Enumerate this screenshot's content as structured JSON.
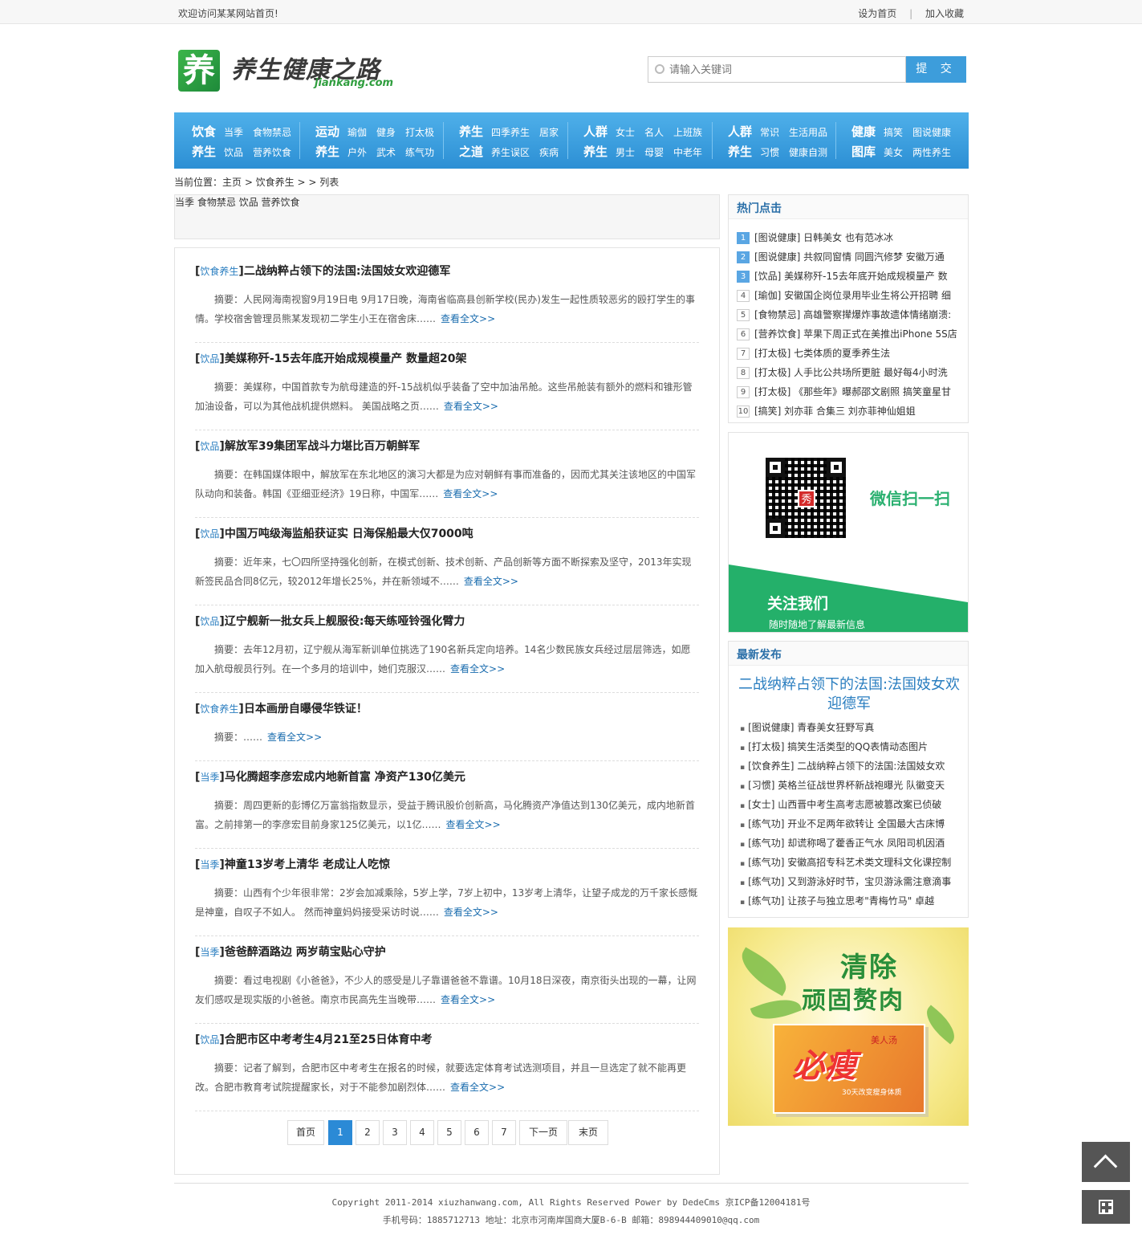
{
  "topbar": {
    "welcome": "欢迎访问某某网站首页!",
    "set_home": "设为首页",
    "separator": "|",
    "bookmark": "加入收藏"
  },
  "logo": {
    "mark": "养",
    "name": "养生健康之路",
    "domain": "jiankang.com"
  },
  "search": {
    "placeholder": "请输入关键词",
    "button": "提 交"
  },
  "nav": [
    {
      "head1": "饮食",
      "subs1": [
        "当季",
        "食物禁忌"
      ],
      "head2": "养生",
      "subs2": [
        "饮品",
        "营养饮食"
      ]
    },
    {
      "head1": "运动",
      "subs1": [
        "瑜伽",
        "健身",
        "打太极"
      ],
      "head2": "养生",
      "subs2": [
        "户外",
        "武术",
        "练气功"
      ]
    },
    {
      "head1": "养生",
      "subs1": [
        "四季养生",
        "居家"
      ],
      "head2": "之道",
      "subs2": [
        "养生误区",
        "疾病"
      ]
    },
    {
      "head1": "人群",
      "subs1": [
        "女士",
        "名人",
        "上班族"
      ],
      "head2": "养生",
      "subs2": [
        "男士",
        "母婴",
        "中老年"
      ]
    },
    {
      "head1": "人群",
      "subs1": [
        "常识",
        "生活用品"
      ],
      "head2": "养生",
      "subs2": [
        "习惯",
        "健康自测"
      ]
    },
    {
      "head1": "健康",
      "subs1": [
        "搞笑",
        "图说健康"
      ],
      "head2": "图库",
      "subs2": [
        "美女",
        "两性养生"
      ]
    }
  ],
  "breadcrumb": "当前位置：主页 > 饮食养生 > > 列表",
  "categories": [
    "当季",
    "食物禁忌",
    "饮品",
    "营养饮食"
  ],
  "articles": [
    {
      "cat": "饮食养生",
      "title": "二战纳粹占领下的法国:法国妓女欢迎德军",
      "summary": "摘要：人民网海南视窗9月19日电 9月17日晚，海南省临高县创新学校(民办)发生一起性质较恶劣的殴打学生的事情。学校宿舍管理员熊某发现初二学生小王在宿舍床……",
      "more": "查看全文>>"
    },
    {
      "cat": "饮品",
      "title": "美媒称歼-15去年底开始成规模量产  数量超20架",
      "summary": "摘要：美媒称，中国首款专为航母建造的歼-15战机似乎装备了空中加油吊舱。这些吊舱装有额外的燃料和锥形管加油设备，可以为其他战机提供燃料。 美国战略之页……",
      "more": "查看全文>>"
    },
    {
      "cat": "饮品",
      "title": "解放军39集团军战斗力堪比百万朝鲜军",
      "summary": "摘要：在韩国媒体眼中，解放军在东北地区的演习大都是为应对朝鲜有事而准备的，因而尤其关注该地区的中国军队动向和装备。韩国《亚细亚经济》19日称，中国军……",
      "more": "查看全文>>"
    },
    {
      "cat": "饮品",
      "title": "中国万吨级海监船获证实  日海保船最大仅7000吨",
      "summary": "摘要：近年来，七〇四所坚持强化创新，在模式创新、技术创新、产品创新等方面不断探索及坚守，2013年实现新签民品合同8亿元，较2012年增长25%，并在新领域不……",
      "more": "查看全文>>"
    },
    {
      "cat": "饮品",
      "title": "辽宁舰新一批女兵上舰服役:每天练哑铃强化臂力",
      "summary": "摘要：去年12月初，辽宁舰从海军新训单位挑选了190名新兵定向培养。14名少数民族女兵经过层层筛选，如愿加入航母舰员行列。在一个多月的培训中，她们克服汉……",
      "more": "查看全文>>"
    },
    {
      "cat": "饮食养生",
      "title": "日本画册自曝侵华铁证！",
      "summary": "摘要：……",
      "more": "查看全文>>"
    },
    {
      "cat": "当季",
      "title": "马化腾超李彦宏成内地新首富  净资产130亿美元",
      "summary": "摘要：周四更新的彭博亿万富翁指数显示，受益于腾讯股价创新高，马化腾资产净值达到130亿美元，成内地新首富。之前排第一的李彦宏目前身家125亿美元，以1亿……",
      "more": "查看全文>>"
    },
    {
      "cat": "当季",
      "title": "神童13岁考上清华  老成让人吃惊",
      "summary": "摘要：山西有个少年很非常：2岁会加减乘除，5岁上学，7岁上初中，13岁考上清华，让望子成龙的万千家长感慨是神童，自叹子不如人。 然而神童妈妈接受采访时说……",
      "more": "查看全文>>"
    },
    {
      "cat": "当季",
      "title": "爸爸醉酒路边  两岁萌宝贴心守护",
      "summary": "摘要：看过电视剧《小爸爸》，不少人的感受是儿子靠谱爸爸不靠谱。10月18日深夜，南京街头出现的一幕，让网友们感叹是现实版的小爸爸。南京市民高先生当晚带……",
      "more": "查看全文>>"
    },
    {
      "cat": "饮品",
      "title": "合肥市区中考考生4月21至25日体育中考",
      "summary": "摘要：记者了解到，合肥市区中考考生在报名的时候，就要选定体育考试选测项目，并且一旦选定了就不能再更改。合肥市教育考试院提醒家长，对于不能参加剧烈体……",
      "more": "查看全文>>"
    }
  ],
  "pager": [
    "首页",
    "1",
    "2",
    "3",
    "4",
    "5",
    "6",
    "7",
    "下一页",
    "末页"
  ],
  "pager_current": 1,
  "hot": {
    "title": "热门点击",
    "items": [
      "[图说健康] 日韩美女 也有范冰冰",
      "[图说健康] 共叙同窗情 同圆汽修梦 安徽万通",
      "[饮品] 美媒称歼-15去年底开始成规模量产 数",
      "[瑜伽] 安徽国企岗位录用毕业生将公开招聘 细",
      "[食物禁忌] 高雄警察撵爆炸事故遗体情绪崩溃:",
      "[营养饮食] 苹果下周正式在美推出iPhone 5S店",
      "[打太极] 七类体质的夏季养生法",
      "[打太极] 人手比公共场所更脏 最好每4小时洗",
      "[打太极] 《那些年》曝郝邵文剧照 搞笑童星甘",
      "[搞笑] 刘亦菲 合集三 刘亦菲神仙姐姐"
    ]
  },
  "wechat": {
    "qr_center": "秀",
    "scan": "微信扫一扫",
    "follow": "关注我们",
    "follow_sub": "随时随地了解最新信息"
  },
  "latest": {
    "title": "最新发布",
    "headline": "二战纳粹占领下的法国:法国妓女欢迎德军",
    "items": [
      "[图说健康] 青春美女狂野写真",
      "[打太极] 搞笑生活类型的QQ表情动态图片",
      "[饮食养生] 二战纳粹占领下的法国:法国妓女欢",
      "[习惯] 英格兰征战世界杯新战袍曝光 队徽变天",
      "[女士] 山西晋中考生高考志愿被篡改案已侦破",
      "[练气功] 开业不足两年欲转让 全国最大古床博",
      "[练气功] 却谎称喝了藿香正气水 凤阳司机因酒",
      "[练气功] 安徽高招专科艺术类文理科文化课控制",
      "[练气功] 又到游泳好时节，宝贝游泳需注意滴事",
      "[练气功] 让孩子与独立思考\"青梅竹马\" 卓越"
    ]
  },
  "ad": {
    "line1": "清除",
    "line2": "顽固赘肉",
    "brand": "必瘦",
    "brand_sub": "美人汤",
    "desc": "30天改变瘦身体质"
  },
  "footer": {
    "line1": "Copyright 2011-2014 xiuzhanwang.com, All Rights Reserved Power by DedeCms 京ICP备12004181号",
    "line2": "手机号码：1885712713 地址：北京市河南岸国商大厦B-6-B 邮箱：898944409010@qq.com"
  }
}
